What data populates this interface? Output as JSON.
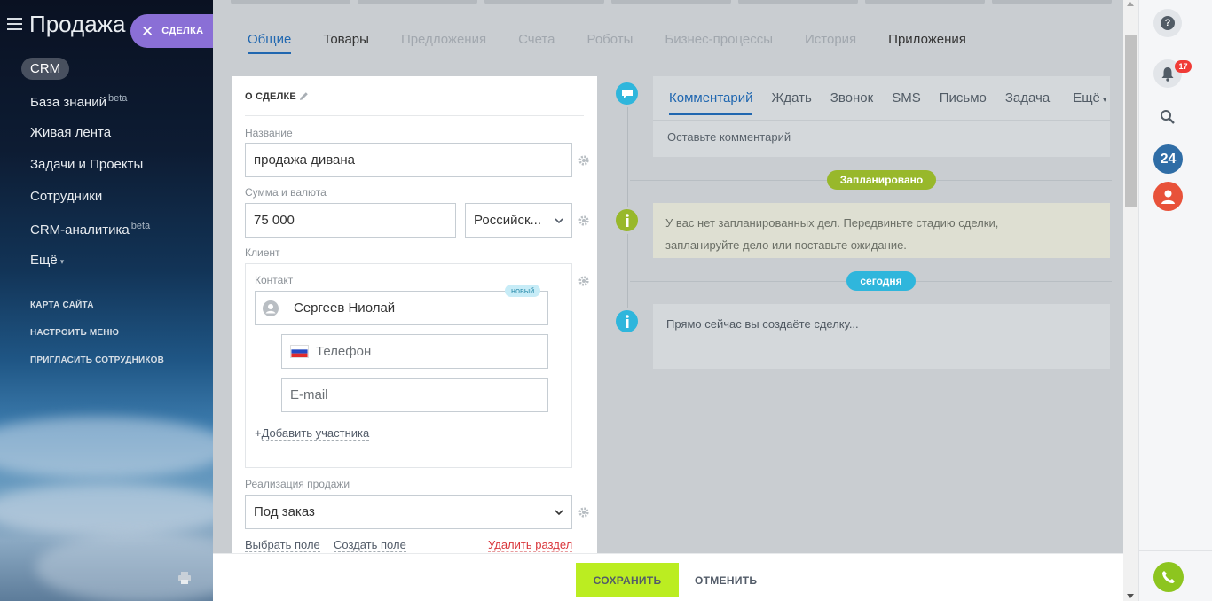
{
  "sidebar": {
    "title": "Продажа",
    "close_chip_label": "СДЕЛКА",
    "crm_badge": "CRM",
    "nav": [
      {
        "label": "База знаний",
        "sup": "beta"
      },
      {
        "label": "Живая лента",
        "sup": ""
      },
      {
        "label": "Задачи и Проекты",
        "sup": ""
      },
      {
        "label": "Сотрудники",
        "sup": ""
      },
      {
        "label": "CRM-аналитика",
        "sup": "beta"
      },
      {
        "label": "Ещё",
        "sup": ""
      }
    ],
    "small_links": [
      "КАРТА САЙТА",
      "НАСТРОИТЬ МЕНЮ",
      "ПРИГЛАСИТЬ СОТРУДНИКОВ"
    ]
  },
  "tabs": [
    {
      "label": "Общие",
      "state": "active"
    },
    {
      "label": "Товары",
      "state": "dark"
    },
    {
      "label": "Предложения",
      "state": "muted"
    },
    {
      "label": "Счета",
      "state": "muted"
    },
    {
      "label": "Роботы",
      "state": "muted"
    },
    {
      "label": "Бизнес-процессы",
      "state": "muted"
    },
    {
      "label": "История",
      "state": "muted"
    },
    {
      "label": "Приложения",
      "state": "dark"
    }
  ],
  "form": {
    "section_title": "О СДЕЛКЕ",
    "name_label": "Название",
    "name_value": "продажа дивана",
    "amount_label": "Сумма и валюта",
    "amount_value": "75 000",
    "currency_value": "Российск...",
    "client_label": "Клиент",
    "contact_label": "Контакт",
    "new_badge": "новый",
    "contact_value": "Сергеев Ниолай",
    "phone_placeholder": "Телефон",
    "email_placeholder": "E-mail",
    "add_participant": "Добавить участника",
    "sale_label": "Реализация продажи",
    "sale_value": "Под заказ",
    "choose_field": "Выбрать поле",
    "create_field": "Создать поле",
    "delete_section": "Удалить раздел"
  },
  "timeline": {
    "activity_tabs": [
      "Комментарий",
      "Ждать",
      "Звонок",
      "SMS",
      "Письмо",
      "Задача",
      "Ещё"
    ],
    "comment_placeholder": "Оставьте комментарий",
    "planned_pill": "Запланировано",
    "planned_text": "У вас нет запланированных дел. Передвиньте стадию сделки, запланируйте дело или поставьте ожидание.",
    "today_pill": "сегодня",
    "now_text": "Прямо сейчас вы создаёте сделку..."
  },
  "rightbar": {
    "notification_count": "17",
    "b24_label": "24"
  },
  "footer": {
    "save_label": "СОХРАНИТЬ",
    "cancel_label": "ОТМЕНИТЬ"
  },
  "colors": {
    "accent": "#2067b0",
    "chip_purple": "#8a6fd6",
    "save_green": "#bbed21",
    "timeline_blue": "#2fb6dc",
    "timeline_green": "#98b82b",
    "danger": "#d9363b"
  },
  "icons": [
    "hamburger-icon",
    "close-icon",
    "pencil-icon",
    "gear-icon",
    "chevron-down-icon",
    "person-icon",
    "russian-flag-icon",
    "comment-icon",
    "info-icon",
    "help-icon",
    "bell-icon",
    "search-icon",
    "user-icon",
    "phone-icon",
    "printer-icon"
  ]
}
